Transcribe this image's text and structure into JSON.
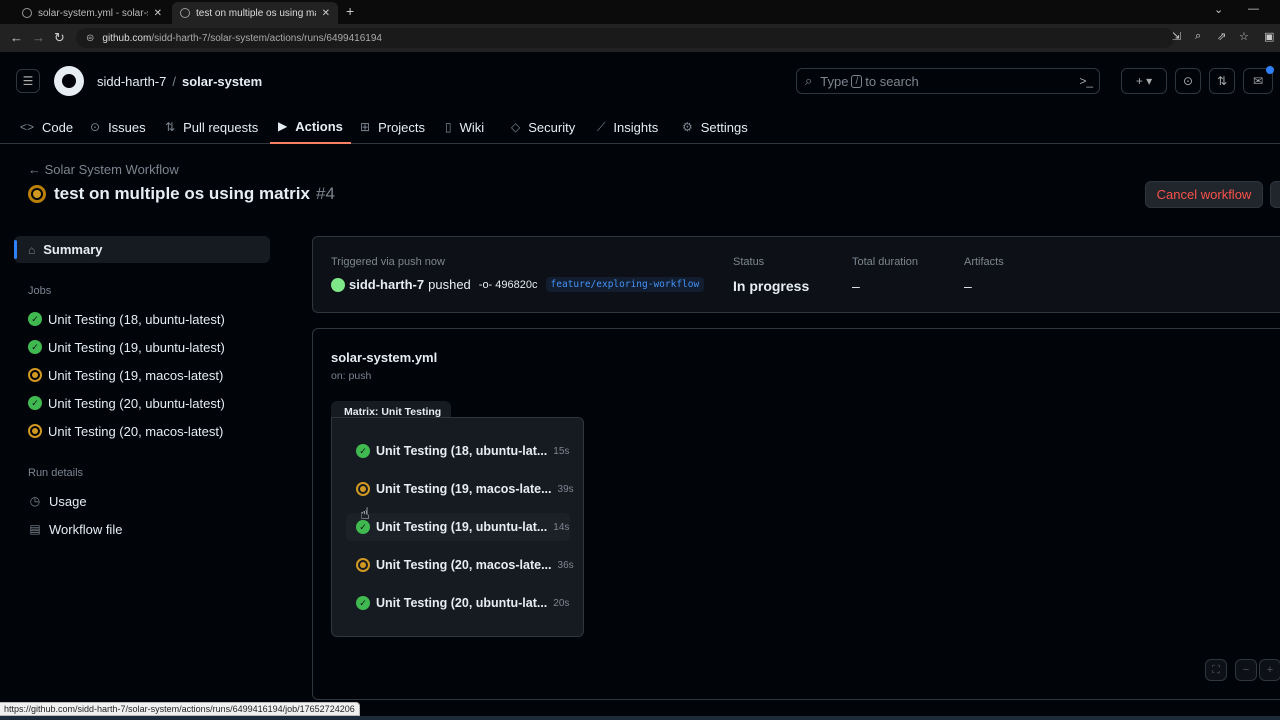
{
  "browser": {
    "tabs": [
      {
        "title": "solar-system.yml - solar-system"
      },
      {
        "title": "test on multiple os using matrix"
      }
    ],
    "url_host": "github.com",
    "url_path": "/sidd-harth-7/solar-system/actions/runs/6499416194",
    "status_url": "https://github.com/sidd-harth-7/solar-system/actions/runs/6499416194/job/17652724206"
  },
  "header": {
    "owner": "sidd-harth-7",
    "repo": "solar-system",
    "search_pre": "Type",
    "search_key": "/",
    "search_post": "to search"
  },
  "repo_nav": [
    {
      "label": "Code",
      "icon": "code-icon"
    },
    {
      "label": "Issues",
      "icon": "issue-icon"
    },
    {
      "label": "Pull requests",
      "icon": "pull-request-icon"
    },
    {
      "label": "Actions",
      "icon": "play-icon"
    },
    {
      "label": "Projects",
      "icon": "table-icon"
    },
    {
      "label": "Wiki",
      "icon": "book-icon"
    },
    {
      "label": "Security",
      "icon": "shield-icon"
    },
    {
      "label": "Insights",
      "icon": "graph-icon"
    },
    {
      "label": "Settings",
      "icon": "gear-icon"
    }
  ],
  "run": {
    "back_label": "Solar System Workflow",
    "title": "test on multiple os using matrix",
    "number": "#4",
    "cancel_label": "Cancel workflow"
  },
  "sidebar": {
    "summary": "Summary",
    "jobs_heading": "Jobs",
    "jobs": [
      {
        "label": "Unit Testing (18, ubuntu-latest)",
        "status": "success"
      },
      {
        "label": "Unit Testing (19, ubuntu-latest)",
        "status": "success"
      },
      {
        "label": "Unit Testing (19, macos-latest)",
        "status": "in_progress"
      },
      {
        "label": "Unit Testing (20, ubuntu-latest)",
        "status": "success"
      },
      {
        "label": "Unit Testing (20, macos-latest)",
        "status": "in_progress"
      }
    ],
    "run_details_heading": "Run details",
    "usage": "Usage",
    "workflow_file": "Workflow file"
  },
  "summary": {
    "triggered": "Triggered via push now",
    "user": "sidd-harth-7",
    "verb": "pushed",
    "commit": "496820c",
    "branch": "feature/exploring-workflow",
    "status_label": "Status",
    "status_value": "In progress",
    "duration_label": "Total duration",
    "duration_value": "–",
    "artifacts_label": "Artifacts",
    "artifacts_value": "–"
  },
  "graph": {
    "file": "solar-system.yml",
    "trigger": "on: push",
    "matrix_label": "Matrix: Unit Testing",
    "jobs": [
      {
        "name": "Unit Testing (18, ubuntu-lat...",
        "duration": "15s",
        "status": "success"
      },
      {
        "name": "Unit Testing (19, macos-late...",
        "duration": "39s",
        "status": "in_progress"
      },
      {
        "name": "Unit Testing (19, ubuntu-lat...",
        "duration": "14s",
        "status": "success"
      },
      {
        "name": "Unit Testing (20, macos-late...",
        "duration": "36s",
        "status": "in_progress"
      },
      {
        "name": "Unit Testing (20, ubuntu-lat...",
        "duration": "20s",
        "status": "success"
      }
    ]
  },
  "colors": {
    "accent": "#f78166",
    "success": "#3fb950",
    "in_progress": "#d29922",
    "danger": "#f85149",
    "link": "#4493f8"
  }
}
